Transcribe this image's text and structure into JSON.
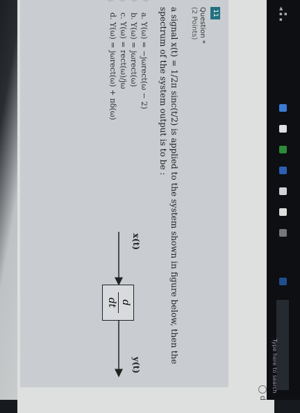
{
  "header": {
    "choice_label": "d"
  },
  "question": {
    "number": "11",
    "label": "Question *",
    "points": "(2 Points)",
    "text": "a signal x(t) = 1/2π sinc(t/2) is applied to the system shown in figure below, then the spectrum of the system output is to be :",
    "options": [
      "a. Y(ω) = −jωrect(ω − 2)",
      "b. Y(ω) = jωrect(ω)",
      "c. Y(ω) = rect(ω)/jω",
      "d. Y(ω) = jωrect(ω) + πδ(ω)"
    ]
  },
  "diagram": {
    "input_label": "x(t)",
    "output_label": "y(t)",
    "op_numerator": "d",
    "op_denominator": "dt"
  },
  "taskbar": {
    "search_placeholder": "Type here to search"
  },
  "colors": {
    "accent": "#22707f",
    "taskbar": "#0d0f12"
  }
}
